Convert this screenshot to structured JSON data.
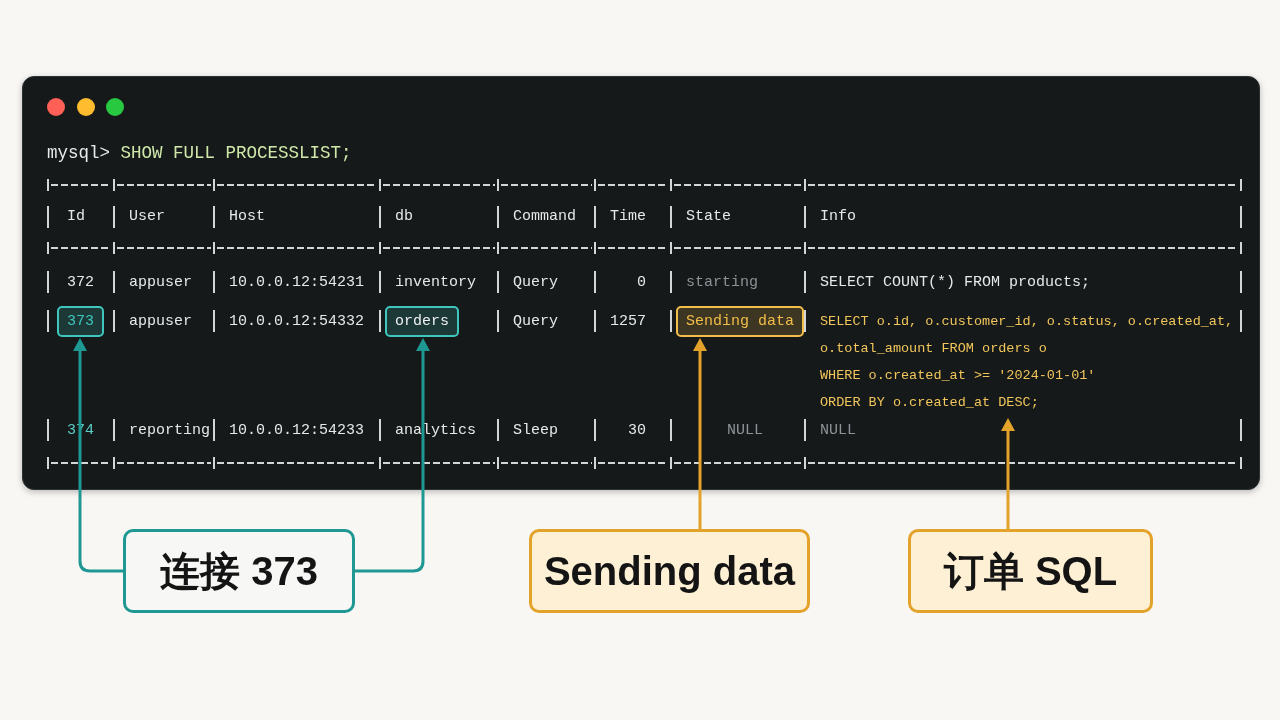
{
  "prompt": {
    "prefix": "mysql>",
    "command": "SHOW FULL PROCESSLIST;"
  },
  "table": {
    "columns": [
      "Id",
      "User",
      "Host",
      "db",
      "Command",
      "Time",
      "State",
      "Info"
    ],
    "rows": [
      {
        "cells": [
          {
            "text": "372",
            "kind": "plain"
          },
          {
            "text": "appuser",
            "kind": "plain"
          },
          {
            "text": "10.0.0.12:54231",
            "kind": "plain"
          },
          {
            "text": "inventory",
            "kind": "plain"
          },
          {
            "text": "Query",
            "kind": "plain"
          },
          {
            "text": "0",
            "kind": "plain"
          },
          {
            "text": "starting",
            "kind": "dim"
          },
          {
            "text": "SELECT COUNT(*) FROM products;",
            "kind": "plain"
          }
        ]
      },
      {
        "cells": [
          {
            "text": "373",
            "kind": "boxed_accent",
            "color": "#3fc6bd"
          },
          {
            "text": "appuser",
            "kind": "plain"
          },
          {
            "text": "10.0.0.12:54332",
            "kind": "plain"
          },
          {
            "text": "orders",
            "kind": "boxed",
            "color": "#3fc6bd"
          },
          {
            "text": "Query",
            "kind": "plain"
          },
          {
            "text": "1257",
            "kind": "plain"
          },
          {
            "text": "Sending data",
            "kind": "boxed_accent",
            "color": "#f2bd48"
          },
          {
            "lines": [
              "SELECT o.id, o.customer_id, o.status, o.created_at,",
              "o.total_amount FROM orders o",
              "WHERE o.created_at >= '2024-01-01'",
              "ORDER BY o.created_at DESC;"
            ],
            "kind": "accent",
            "color": "#f2c65a"
          }
        ]
      },
      {
        "cells": [
          {
            "text": "374",
            "kind": "accent",
            "color": "#5ccfc6"
          },
          {
            "text": "reporting",
            "kind": "plain"
          },
          {
            "text": "10.0.0.12:54233",
            "kind": "plain"
          },
          {
            "text": "analytics",
            "kind": "plain"
          },
          {
            "text": "Sleep",
            "kind": "plain"
          },
          {
            "text": "30",
            "kind": "plain"
          },
          {
            "text": "NULL",
            "kind": "null"
          },
          {
            "text": "NULL",
            "kind": "null"
          }
        ]
      }
    ]
  },
  "callouts": [
    {
      "text": "连接 373",
      "kind": "plain",
      "color": "#1f9792"
    },
    {
      "text": "Sending data",
      "kind": "tinted",
      "color": "#e3a22a"
    },
    {
      "text": "订单 SQL",
      "kind": "tinted",
      "color": "#e3a22a"
    }
  ]
}
